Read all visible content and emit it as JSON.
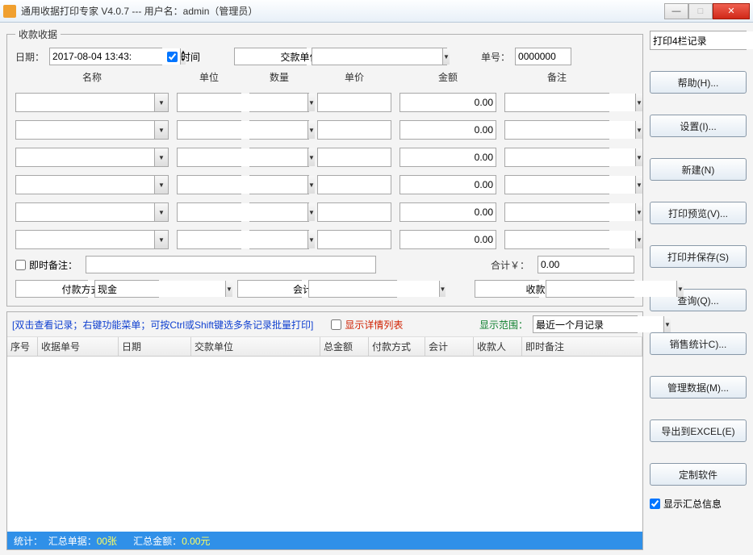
{
  "window": {
    "title": "通用收据打印专家 V4.0.7 --- 用户名：admin（管理员）"
  },
  "receipt": {
    "legend": "收款收据",
    "date_label": "日期：",
    "date_value": "2017-08-04 13:43:",
    "time_label": "时间",
    "time_checked": true,
    "payer_label": "交款单位",
    "payer_value": "",
    "serial_label": "单号：",
    "serial_value": "0000000",
    "headers": {
      "name": "名称",
      "unit": "单位",
      "qty": "数量",
      "price": "单价",
      "amount": "金额",
      "remark": "备注"
    },
    "rows": [
      {
        "name": "",
        "unit": "",
        "qty": "",
        "price": "",
        "amount": "0.00",
        "remark": ""
      },
      {
        "name": "",
        "unit": "",
        "qty": "",
        "price": "",
        "amount": "0.00",
        "remark": ""
      },
      {
        "name": "",
        "unit": "",
        "qty": "",
        "price": "",
        "amount": "0.00",
        "remark": ""
      },
      {
        "name": "",
        "unit": "",
        "qty": "",
        "price": "",
        "amount": "0.00",
        "remark": ""
      },
      {
        "name": "",
        "unit": "",
        "qty": "",
        "price": "",
        "amount": "0.00",
        "remark": ""
      },
      {
        "name": "",
        "unit": "",
        "qty": "",
        "price": "",
        "amount": "0.00",
        "remark": ""
      }
    ],
    "instant_remark_label": "即时备注：",
    "instant_remark_value": "",
    "total_label": "合计￥：",
    "total_value": "0.00",
    "pay_method_label": "付款方式",
    "pay_method_value": "现金",
    "accountant_label": "会计",
    "accountant_value": "",
    "payee_label": "收款人",
    "payee_value": ""
  },
  "list": {
    "hint": "[双击查看记录；右键功能菜单；可按Ctrl或Shift键选多条记录批量打印]",
    "show_detail_label": "显示详情列表",
    "show_detail_checked": false,
    "range_label": "显示范围：",
    "range_value": "最近一个月记录",
    "columns": {
      "seq": "序号",
      "serial": "收据单号",
      "date": "日期",
      "payer": "交款单位",
      "total": "总金额",
      "paymethod": "付款方式",
      "accountant": "会计",
      "payee": "收款人",
      "instant": "即时备注"
    }
  },
  "status": {
    "stat_label": "统计：",
    "count_label": "汇总单据：",
    "count_value": "00张",
    "sum_label": "汇总金额：",
    "sum_value": "0.00元"
  },
  "sidebar": {
    "top_combo": "打印4栏记录",
    "help": "帮助(H)...",
    "settings": "设置(I)...",
    "new": "新建(N)",
    "preview": "打印预览(V)...",
    "print_save": "打印并保存(S)",
    "query": "查询(Q)...",
    "sales": "销售统计C)...",
    "manage": "管理数据(M)...",
    "export": "导出到EXCEL(E)",
    "custom": "定制软件",
    "show_summary_label": "显示汇总信息",
    "show_summary_checked": true
  }
}
